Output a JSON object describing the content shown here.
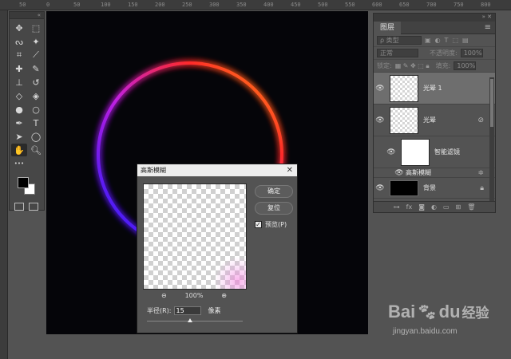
{
  "ruler": {
    "ticks": [
      "50",
      "0",
      "50",
      "100",
      "150",
      "200",
      "250",
      "300",
      "350",
      "400",
      "450",
      "500",
      "550",
      "600",
      "650",
      "700",
      "750",
      "800"
    ]
  },
  "toolbox": {
    "tools": [
      {
        "icon": "move-icon",
        "glyph": "✥"
      },
      {
        "icon": "marquee-icon",
        "glyph": "⬚"
      },
      {
        "icon": "lasso-icon",
        "glyph": "ᔓ"
      },
      {
        "icon": "magic-wand-icon",
        "glyph": "✦"
      },
      {
        "icon": "crop-icon",
        "glyph": "⌗"
      },
      {
        "icon": "eyedropper-icon",
        "glyph": "⟋"
      },
      {
        "icon": "healing-brush-icon",
        "glyph": "✚"
      },
      {
        "icon": "brush-icon",
        "glyph": "✎"
      },
      {
        "icon": "clone-stamp-icon",
        "glyph": "⊥"
      },
      {
        "icon": "history-brush-icon",
        "glyph": "↺"
      },
      {
        "icon": "eraser-icon",
        "glyph": "◇"
      },
      {
        "icon": "paint-bucket-icon",
        "glyph": "◈"
      },
      {
        "icon": "blur-icon",
        "glyph": "●"
      },
      {
        "icon": "dodge-icon",
        "glyph": "○"
      },
      {
        "icon": "pen-icon",
        "glyph": "✒"
      },
      {
        "icon": "type-icon",
        "glyph": "T"
      },
      {
        "icon": "path-selection-icon",
        "glyph": "➤"
      },
      {
        "icon": "ellipse-icon",
        "glyph": "◯"
      },
      {
        "icon": "hand-icon",
        "glyph": "✋"
      },
      {
        "icon": "zoom-icon",
        "glyph": "🔍︎"
      },
      {
        "icon": "more-tools-icon",
        "glyph": "•••"
      }
    ]
  },
  "layers_panel": {
    "tab": "图层",
    "kind_filter": "类型",
    "blend_mode": "正常",
    "opacity_label": "不透明度:",
    "opacity_value": "100%",
    "lock_label": "锁定:",
    "fill_label": "填充:",
    "fill_value": "100%",
    "layers": [
      {
        "name": "光晕 1"
      },
      {
        "name": "光晕"
      },
      {
        "name": "智能滤镜"
      },
      {
        "name": "高斯模糊"
      },
      {
        "name": "背景"
      }
    ]
  },
  "dialog": {
    "title": "高斯模糊",
    "ok_label": "确定",
    "reset_label": "复位",
    "preview_label": "预览(P)",
    "preview_checked": "✓",
    "zoom_value": "100%",
    "zoom_out": "⊖",
    "zoom_in": "⊕",
    "radius_label": "半径(R):",
    "radius_value": "15",
    "radius_unit": "像素",
    "radius_slider_fraction": 0.45
  },
  "watermark": {
    "logo": "Bai",
    "logo_mid": "du",
    "logo_cn": "经验",
    "url": "jingyan.baidu.com"
  },
  "colors": {
    "ring_start": "#1a1aff",
    "ring_mid": "#c020e0",
    "ring_red": "#ff2a2a",
    "ring_end": "#ff9a10"
  }
}
